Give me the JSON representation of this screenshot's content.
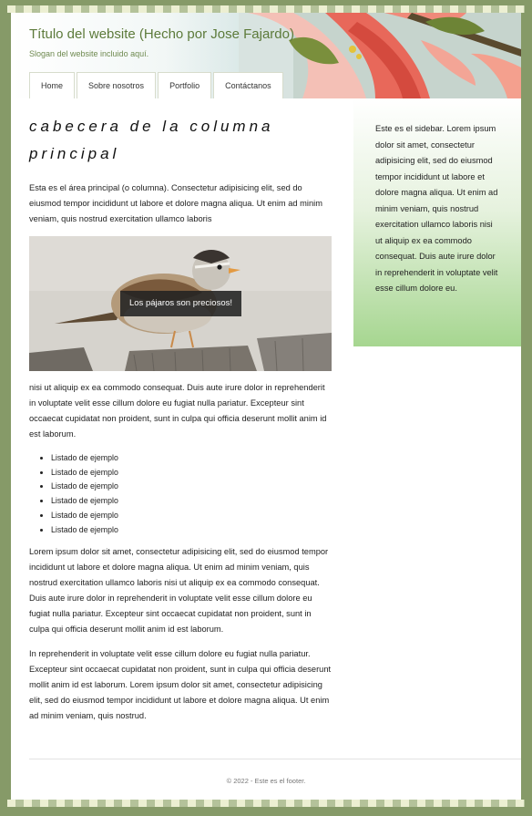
{
  "header": {
    "site_title": "Título del website (Hecho por Jose Fajardo)",
    "slogan": "Slogan del website incluido aquí."
  },
  "nav": {
    "items": [
      {
        "label": "Home"
      },
      {
        "label": "Sobre nosotros"
      },
      {
        "label": "Portfolio"
      },
      {
        "label": "Contáctanos"
      }
    ]
  },
  "main": {
    "heading_line1": "cabecera de la columna",
    "heading_line2": "principal",
    "intro": "Esta es el área principal (o columna). Consectetur adipisicing elit, sed do eiusmod tempor incididunt ut labore et dolore magna aliqua. Ut enim ad minim veniam, quis nostrud exercitation ullamco laboris",
    "image_caption": "Los pájaros son preciosos!",
    "after_image": "nisi ut aliquip ex ea commodo consequat. Duis aute irure dolor in reprehenderit in voluptate velit esse cillum dolore eu fugiat nulla pariatur. Excepteur sint occaecat cupidatat non proident, sunt in culpa qui officia deserunt mollit anim id est laborum.",
    "list": [
      "Listado de ejemplo",
      "Listado de ejemplo",
      "Listado de ejemplo",
      "Listado de ejemplo",
      "Listado de ejemplo",
      "Listado de ejemplo"
    ],
    "paragraph2": "Lorem ipsum dolor sit amet, consectetur adipisicing elit, sed do eiusmod tempor incididunt ut labore et dolore magna aliqua. Ut enim ad minim veniam, quis nostrud exercitation ullamco laboris nisi ut aliquip ex ea commodo consequat. Duis aute irure dolor in reprehenderit in voluptate velit esse cillum dolore eu fugiat nulla pariatur. Excepteur sint occaecat cupidatat non proident, sunt in culpa qui officia deserunt mollit anim id est laborum.",
    "paragraph3": "In reprehenderit in voluptate velit esse cillum dolore eu fugiat nulla pariatur. Excepteur sint occaecat cupidatat non proident, sunt in culpa qui officia deserunt mollit anim id est laborum. Lorem ipsum dolor sit amet, consectetur adipisicing elit, sed do eiusmod tempor incididunt ut labore et dolore magna aliqua. Ut enim ad minim veniam, quis nostrud."
  },
  "sidebar": {
    "text": "Este es el sidebar. Lorem ipsum dolor sit amet, consectetur adipisicing elit, sed do eiusmod tempor incididunt ut labore et dolore magna aliqua. Ut enim ad minim veniam, quis nostrud exercitation ullamco laboris nisi ut aliquip ex ea commodo consequat. Duis aute irure dolor in reprehenderit in voluptate velit esse cillum dolore eu."
  },
  "footer": {
    "text": "© 2022 - Este es el footer."
  },
  "colors": {
    "outer_background": "#869a68",
    "title_green": "#5c7a3a",
    "sidebar_green": "#a6d690"
  }
}
